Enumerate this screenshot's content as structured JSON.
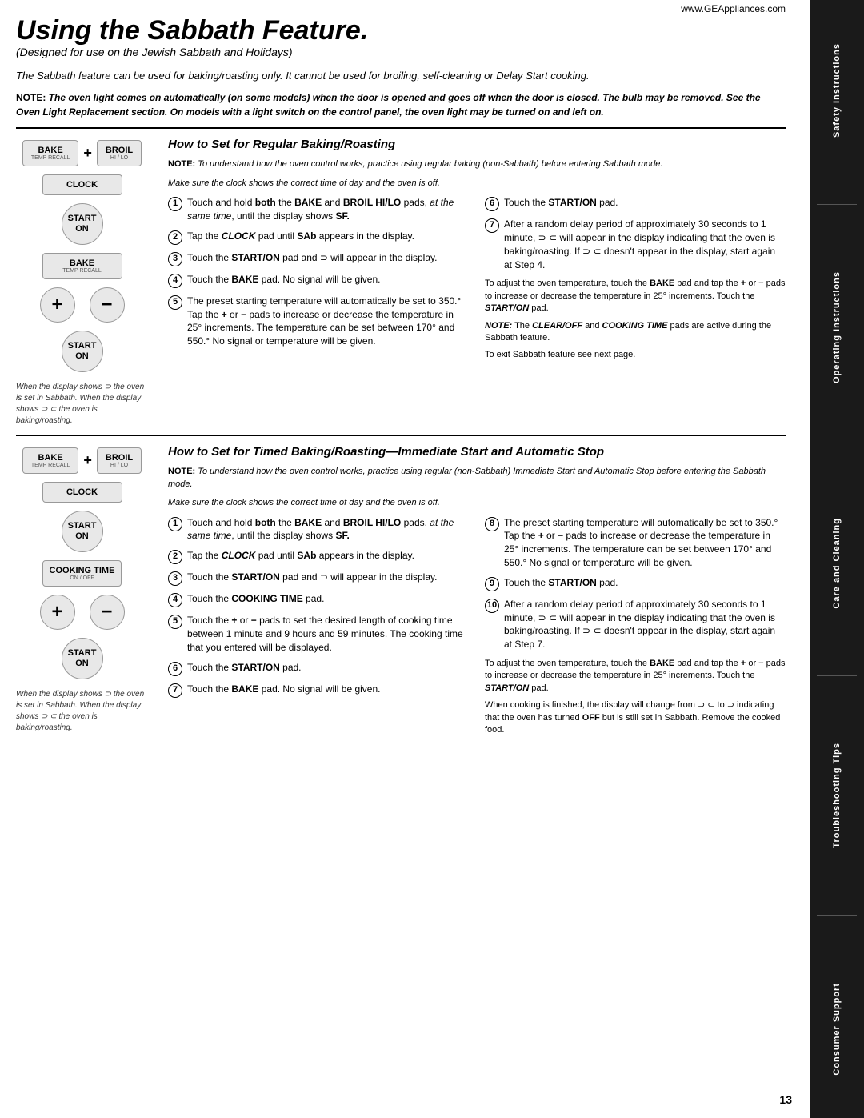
{
  "sidebar": {
    "items": [
      {
        "label": "Safety Instructions"
      },
      {
        "label": "Operating Instructions"
      },
      {
        "label": "Care and Cleaning"
      },
      {
        "label": "Troubleshooting Tips"
      },
      {
        "label": "Consumer Support"
      }
    ]
  },
  "header": {
    "title": "Using the Sabbath Feature.",
    "subtitle": "(Designed for use on the Jewish Sabbath and Holidays)",
    "website": "www.GEAppliances.com"
  },
  "intro": {
    "text": "The Sabbath feature can be used for baking/roasting only. It cannot be used for broiling, self-cleaning or Delay Start cooking.",
    "note": "NOTE: The oven light comes on automatically (on some models) when the door is opened and goes off when the door is closed. The bulb may be removed. See the Oven Light Replacement section. On models with a light switch on the control panel, the oven light may be turned on and left on."
  },
  "section1": {
    "title": "How to Set for Regular Baking/Roasting",
    "note1_label": "NOTE:",
    "note1": "To understand how the oven control works, practice using regular baking (non-Sabbath) before entering Sabbath mode.",
    "note2": "Make sure the clock shows the correct time of day and the oven is off.",
    "steps": [
      {
        "num": "1",
        "text": "Touch and hold both the BAKE and BROIL HI/LO pads, at the same time, until the display shows SF."
      },
      {
        "num": "2",
        "text": "Tap the CLOCK pad until SAb appears in the display."
      },
      {
        "num": "3",
        "text": "Touch the START/ON pad and ⊃ will appear in the display."
      },
      {
        "num": "4",
        "text": "Touch the BAKE pad. No signal will be given."
      },
      {
        "num": "5",
        "text": "The preset starting temperature will automatically be set to 350.° Tap the + or − pads to increase or decrease the temperature in 25° increments. The temperature can be set between 170° and 550.° No signal or temperature will be given."
      }
    ],
    "steps_right": [
      {
        "num": "6",
        "text": "Touch the START/ON pad."
      },
      {
        "num": "7",
        "text": "After a random delay period of approximately 30 seconds to 1 minute, ⊃ ⊂ will appear in the display indicating that the oven is baking/roasting. If ⊃ ⊂ doesn't appear in the display, start again at Step 4."
      }
    ],
    "adjust_text": "To adjust the oven temperature, touch the BAKE pad and tap the + or − pads to increase or decrease the temperature in 25° increments. Touch the START/ON pad.",
    "note3": "NOTE: The CLEAR/OFF and COOKING TIME pads are active during the Sabbath feature.",
    "exit_text": "To exit Sabbath feature see next page.",
    "caption": "When the display shows ⊃ the oven is set in Sabbath. When the display shows ⊃ ⊂ the oven is baking/roasting."
  },
  "section2": {
    "title": "How to Set for Timed Baking/Roasting—Immediate Start and Automatic Stop",
    "note1_label": "NOTE:",
    "note1": "To understand how the oven control works, practice using regular (non-Sabbath) Immediate Start and Automatic Stop before entering the Sabbath mode.",
    "note2": "Make sure the clock shows the correct time of day and the oven is off.",
    "steps": [
      {
        "num": "1",
        "text": "Touch and hold both the BAKE and BROIL HI/LO pads, at the same time, until the display shows SF."
      },
      {
        "num": "2",
        "text": "Tap the CLOCK pad until SAb appears in the display."
      },
      {
        "num": "3",
        "text": "Touch the START/ON pad and ⊃ will appear in the display."
      },
      {
        "num": "4",
        "text": "Touch the COOKING TIME pad."
      },
      {
        "num": "5",
        "text": "Touch the + or − pads to set the desired length of cooking time between 1 minute and 9 hours and 59 minutes. The cooking time that you entered will be displayed."
      },
      {
        "num": "6",
        "text": "Touch the START/ON pad."
      },
      {
        "num": "7",
        "text": "Touch the BAKE pad. No signal will be given."
      }
    ],
    "steps_right": [
      {
        "num": "8",
        "text": "The preset starting temperature will automatically be set to 350.° Tap the + or − pads to increase or decrease the temperature in 25° increments. The temperature can be set between 170° and 550.° No signal or temperature will be given."
      },
      {
        "num": "9",
        "text": "Touch the START/ON pad."
      },
      {
        "num": "10",
        "text": "After a random delay period of approximately 30 seconds to 1 minute, ⊃ ⊂ will appear in the display indicating that the oven is baking/roasting. If ⊃ ⊂ doesn't appear in the display, start again at Step 7."
      }
    ],
    "adjust_text": "To adjust the oven temperature, touch the BAKE pad and tap the + or − pads to increase or decrease the temperature in 25° increments. Touch the START/ON pad.",
    "finish_text": "When cooking is finished, the display will change from ⊃ ⊂ to ⊃ indicating that the oven has turned OFF but is still set in Sabbath. Remove the cooked food.",
    "caption": "When the display shows ⊃ the oven is set in Sabbath. When the display shows ⊃ ⊂ the oven is baking/roasting."
  },
  "page_number": "13",
  "buttons": {
    "bake_label": "BAKE",
    "bake_sub": "TEMP RECALL",
    "broil_label": "BROIL",
    "broil_sub": "HI / LO",
    "clock_label": "CLOCK",
    "start_label": "START",
    "start_sub": "ON",
    "cooking_time_label": "COOKING TIME",
    "cooking_time_sub": "ON / OFF",
    "plus": "+",
    "minus": "−"
  }
}
